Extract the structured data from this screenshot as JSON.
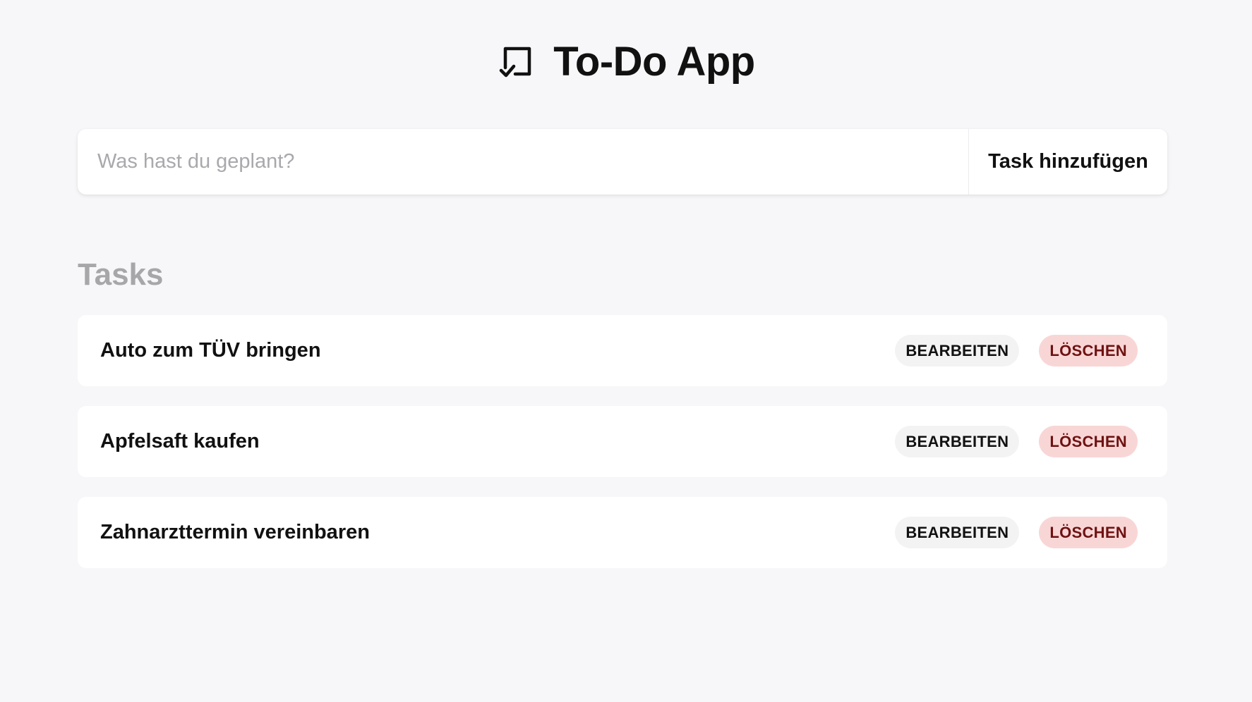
{
  "header": {
    "logo_icon": "checkbox-icon",
    "title": "To-Do App"
  },
  "add_bar": {
    "placeholder": "Was hast du geplant?",
    "value": "",
    "add_label": "Task hinzufügen"
  },
  "tasks_section": {
    "title": "Tasks",
    "items": [
      {
        "label": "Auto zum TÜV bringen",
        "edit_label": "BEARBEITEN",
        "delete_label": "LÖSCHEN"
      },
      {
        "label": "Apfelsaft kaufen",
        "edit_label": "BEARBEITEN",
        "delete_label": "LÖSCHEN"
      },
      {
        "label": "Zahnarzttermin vereinbaren",
        "edit_label": "BEARBEITEN",
        "delete_label": "LÖSCHEN"
      }
    ]
  },
  "colors": {
    "background": "#f7f7f9",
    "card": "#ffffff",
    "section_title": "#a7a7a9",
    "edit_bg": "#f3f3f4",
    "delete_bg": "#f9d6d6",
    "delete_text": "#6e1212"
  }
}
